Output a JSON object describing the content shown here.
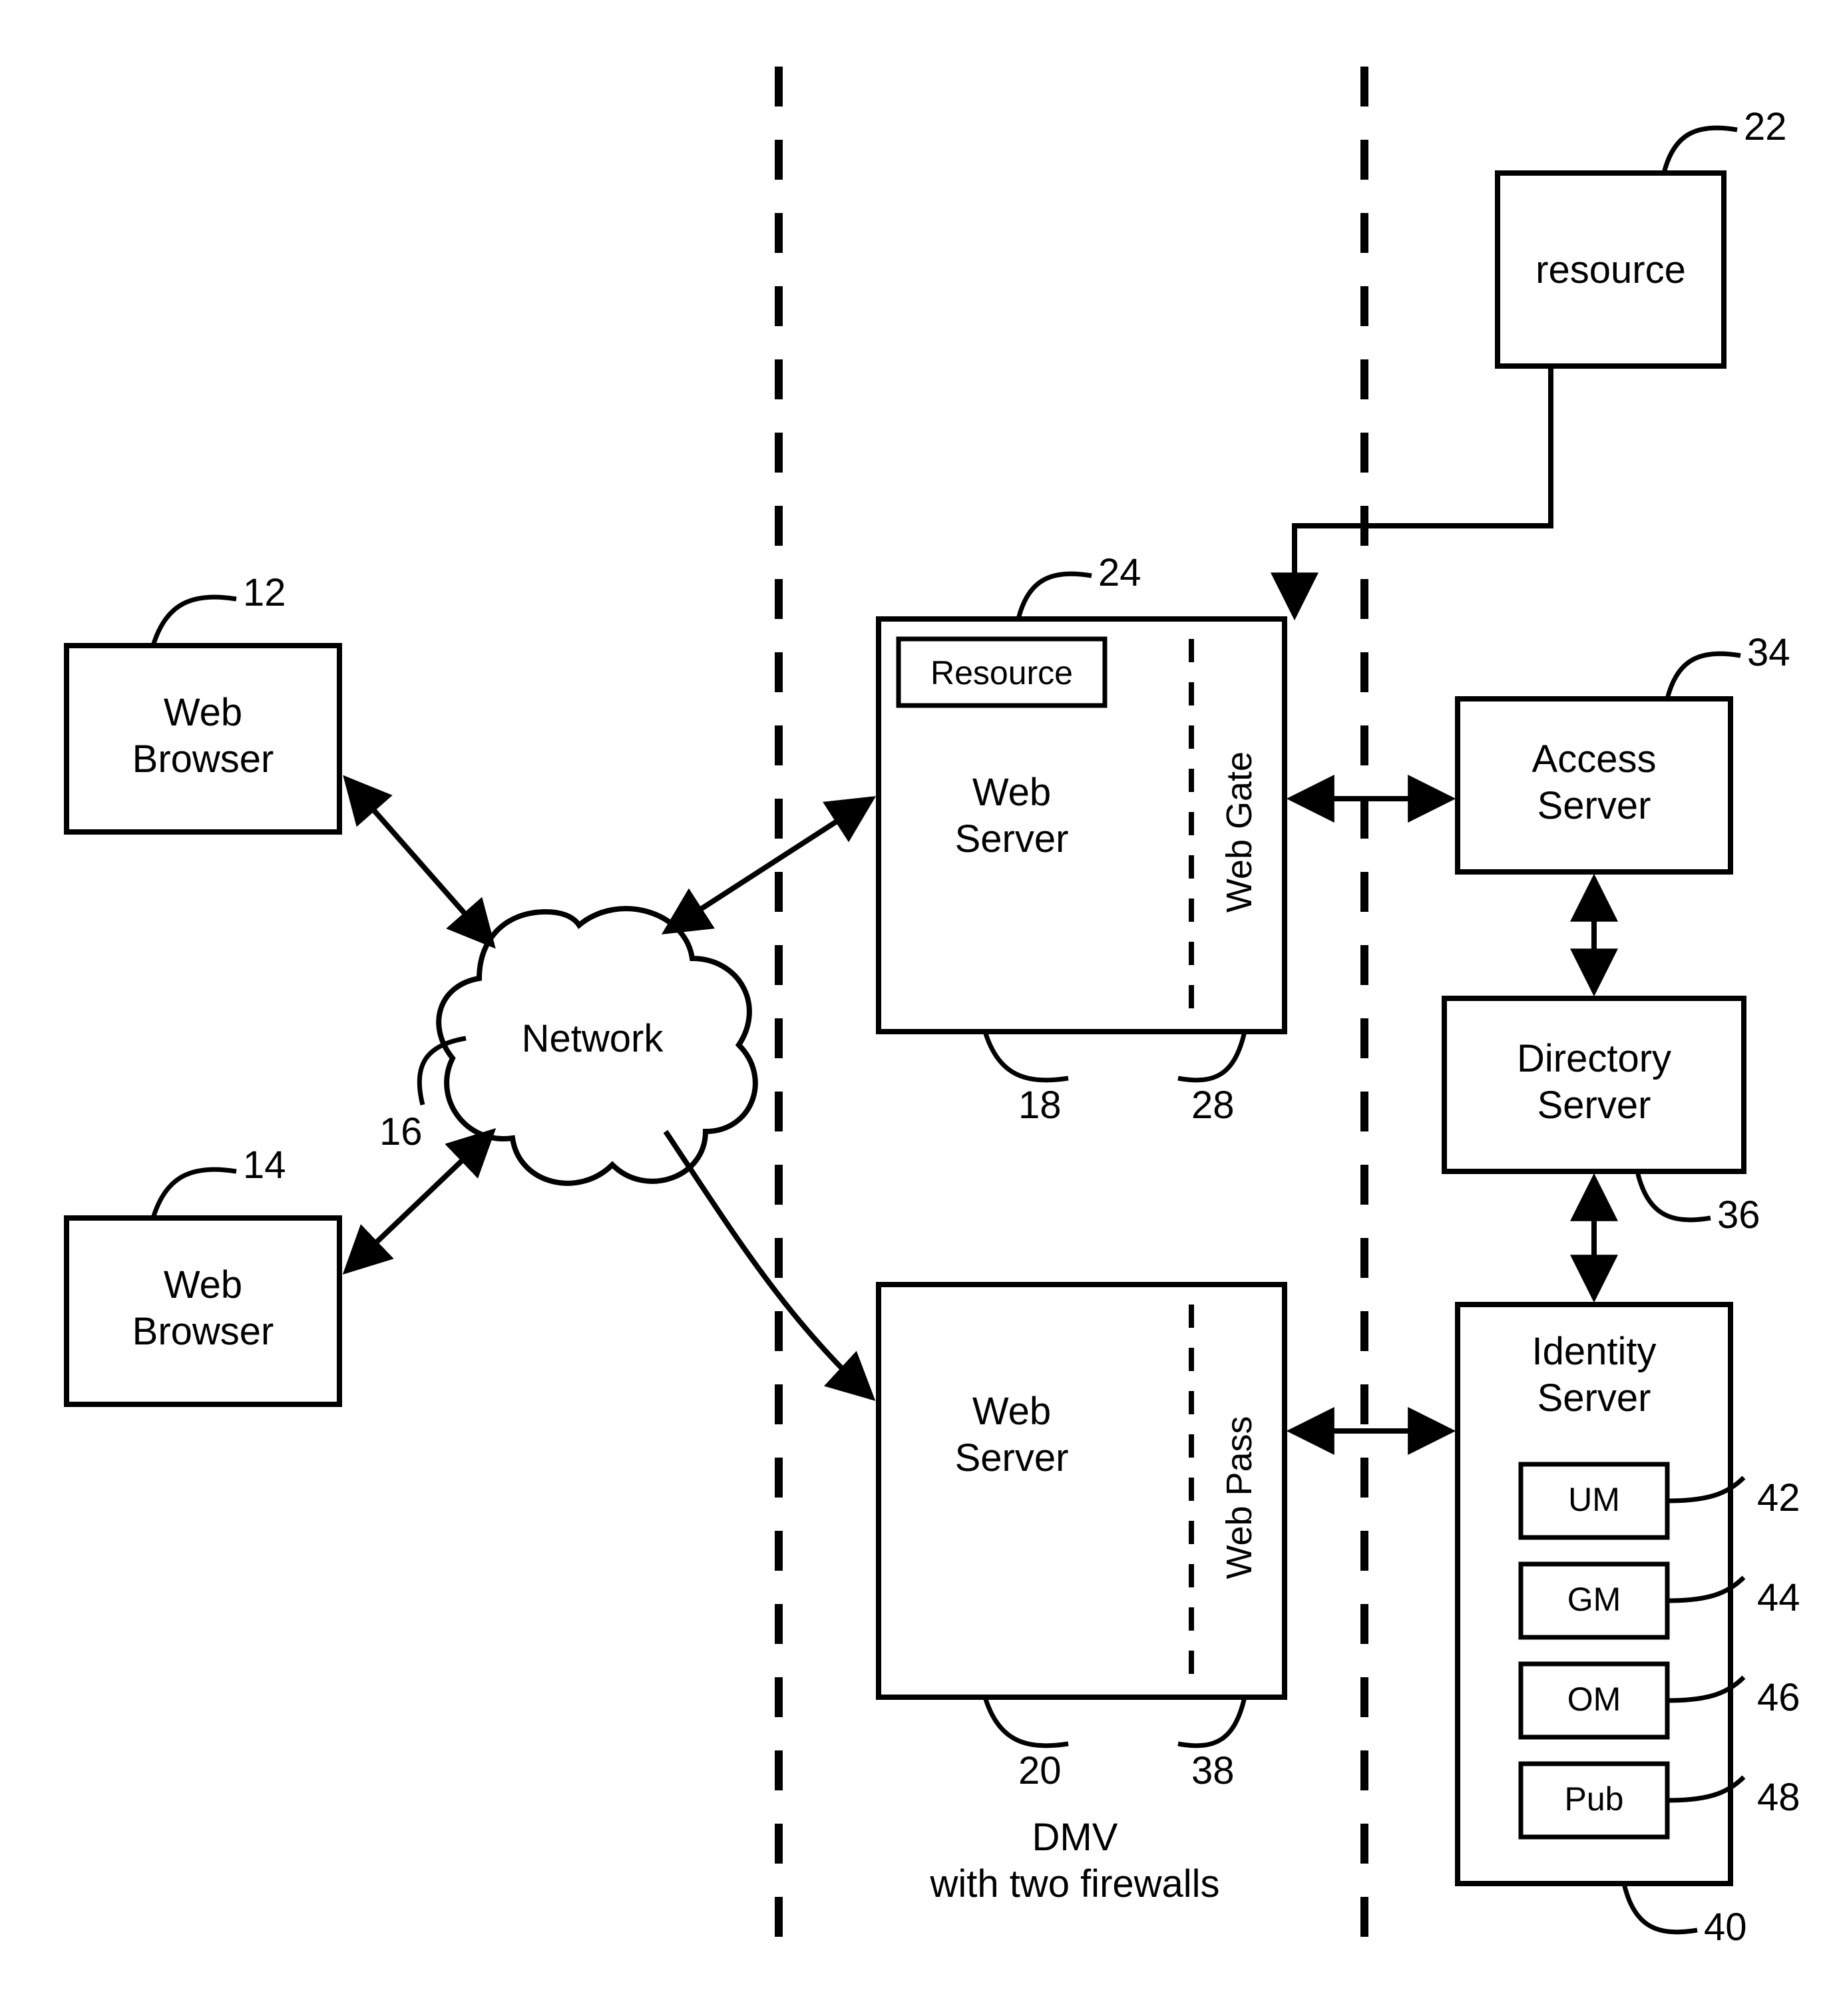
{
  "nodes": {
    "web_browser_1": {
      "label_l1": "Web",
      "label_l2": "Browser",
      "ref": "12"
    },
    "web_browser_2": {
      "label_l1": "Web",
      "label_l2": "Browser",
      "ref": "14"
    },
    "network": {
      "label": "Network",
      "ref": "16"
    },
    "web_server_1": {
      "label_l1": "Web",
      "label_l2": "Server",
      "ref": "18"
    },
    "web_server_2": {
      "label_l1": "Web",
      "label_l2": "Server",
      "ref": "20"
    },
    "resource_inner": {
      "label": "Resource",
      "ref": "24"
    },
    "web_gate": {
      "label": "Web Gate",
      "ref": "28"
    },
    "web_pass": {
      "label": "Web Pass",
      "ref": "38"
    },
    "resource": {
      "label": "resource",
      "ref": "22"
    },
    "access_server": {
      "label_l1": "Access",
      "label_l2": "Server",
      "ref": "34"
    },
    "directory_server": {
      "label_l1": "Directory",
      "label_l2": "Server",
      "ref": "36"
    },
    "identity_server": {
      "label_l1": "Identity",
      "label_l2": "Server",
      "ref": "40"
    },
    "um": {
      "label": "UM",
      "ref": "42"
    },
    "gm": {
      "label": "GM",
      "ref": "44"
    },
    "om": {
      "label": "OM",
      "ref": "46"
    },
    "pub": {
      "label": "Pub",
      "ref": "48"
    }
  },
  "caption": {
    "line1": "DMV",
    "line2": "with  two firewalls"
  }
}
